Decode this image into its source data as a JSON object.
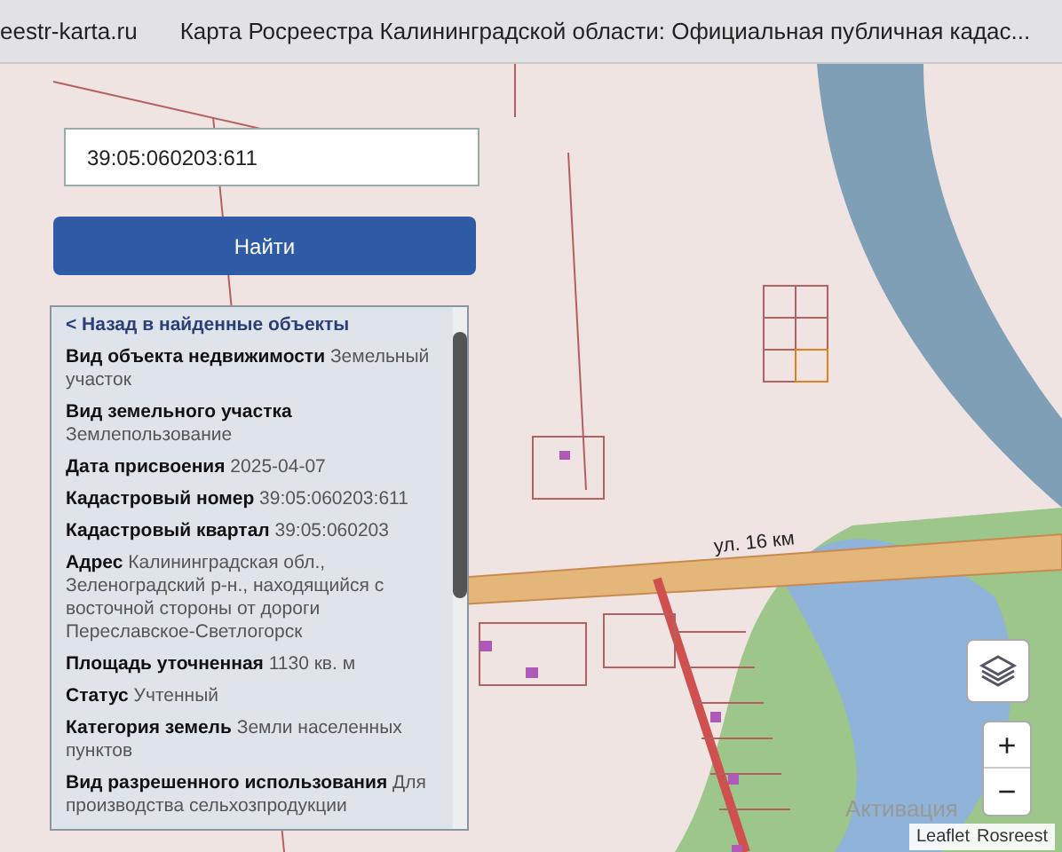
{
  "browser": {
    "site": "eestr-karta.ru",
    "tab_title": "Карта Росреестра Калининградской области: Официальная публичная кадас..."
  },
  "search": {
    "value": "39:05:060203:611"
  },
  "find_button": "Найти",
  "panel": {
    "back_link": "< Назад в найденные объекты",
    "fields": [
      "**Вид объекта недвижимости** Земельный участок",
      "**Вид земельного участка** Землепользование",
      "**Дата присвоения** 2025-04-07",
      "**Кадастровый номер** 39:05:060203:611",
      "**Кадастровый квартал** 39:05:060203",
      "**Адрес** Калининградская обл., Зеленоградский р-н., находящийся с восточной стороны от дороги Переславское-Светлогорск",
      "**Площадь уточненная** 1130 кв. м",
      "**Статус** Учтенный",
      "**Категория земель** Земли населенных пунктов",
      "**Вид разрешенного использования** Для производства сельхозпродукции"
    ]
  },
  "map": {
    "road_label": "ул. 16 км",
    "zoom_in": "+",
    "zoom_out": "−",
    "attribution": [
      "Leaflet",
      "Rosreest"
    ]
  },
  "os_notice": "Активация"
}
